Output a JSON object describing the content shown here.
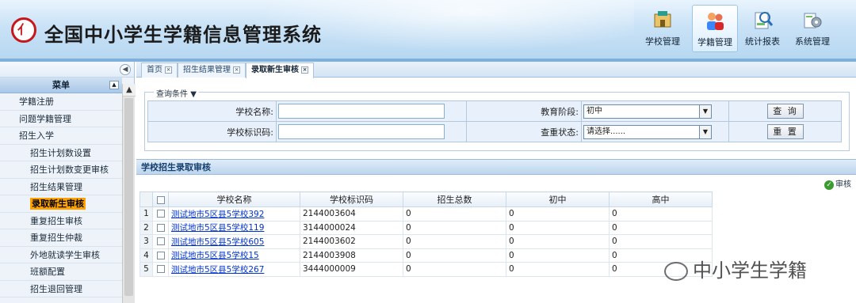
{
  "header": {
    "title": "全国中小学生学籍信息管理系统",
    "logo_glyph": "亻",
    "nav": [
      {
        "label": "学校管理",
        "icon": "school-icon"
      },
      {
        "label": "学籍管理",
        "icon": "students-icon"
      },
      {
        "label": "统计报表",
        "icon": "report-icon"
      },
      {
        "label": "系统管理",
        "icon": "settings-icon"
      }
    ],
    "active_nav": "学籍管理"
  },
  "sidebar": {
    "menu_title": "菜单",
    "items": [
      {
        "label": "学籍注册",
        "level": 1
      },
      {
        "label": "问题学籍管理",
        "level": 1
      },
      {
        "label": "招生入学",
        "level": 1
      },
      {
        "label": "招生计划数设置",
        "level": 2
      },
      {
        "label": "招生计划数变更审核",
        "level": 2
      },
      {
        "label": "招生结果管理",
        "level": 2
      },
      {
        "label": "录取新生审核",
        "level": 2,
        "selected": true
      },
      {
        "label": "重复招生审核",
        "level": 2
      },
      {
        "label": "重复招生仲裁",
        "level": 2
      },
      {
        "label": "外地就读学生审核",
        "level": 2
      },
      {
        "label": "班额配置",
        "level": 2
      },
      {
        "label": "招生退回管理",
        "level": 2
      }
    ]
  },
  "tabs": [
    {
      "label": "首页"
    },
    {
      "label": "招生结果管理"
    },
    {
      "label": "录取新生审核",
      "active": true
    }
  ],
  "query": {
    "legend": "查询条件",
    "school_name_label": "学校名称:",
    "school_name_value": "",
    "school_code_label": "学校标识码:",
    "school_code_value": "",
    "stage_label": "教育阶段:",
    "stage_value": "初中",
    "dup_label": "查重状态:",
    "dup_value": "请选择......",
    "search_button": "查 询",
    "reset_button": "重 置"
  },
  "grid": {
    "title": "学校招生录取审核",
    "audit_button": "审核",
    "columns": [
      "学校名称",
      "学校标识码",
      "招生总数",
      "初中",
      "高中"
    ],
    "rows": [
      {
        "no": "1",
        "name": "测试地市5区县5学校392",
        "code": "2144003604",
        "total": "0",
        "junior": "0",
        "senior": "0"
      },
      {
        "no": "2",
        "name": "测试地市5区县5学校119",
        "code": "3144000024",
        "total": "0",
        "junior": "0",
        "senior": "0"
      },
      {
        "no": "3",
        "name": "测试地市5区县5学校605",
        "code": "2144003602",
        "total": "0",
        "junior": "0",
        "senior": "0"
      },
      {
        "no": "4",
        "name": "测试地市5区县5学校15",
        "code": "2144003908",
        "total": "0",
        "junior": "0",
        "senior": "0"
      },
      {
        "no": "5",
        "name": "测试地市5区县5学校267",
        "code": "3444000009",
        "total": "0",
        "junior": "0",
        "senior": "0"
      }
    ]
  },
  "watermark": "中小学生学籍"
}
